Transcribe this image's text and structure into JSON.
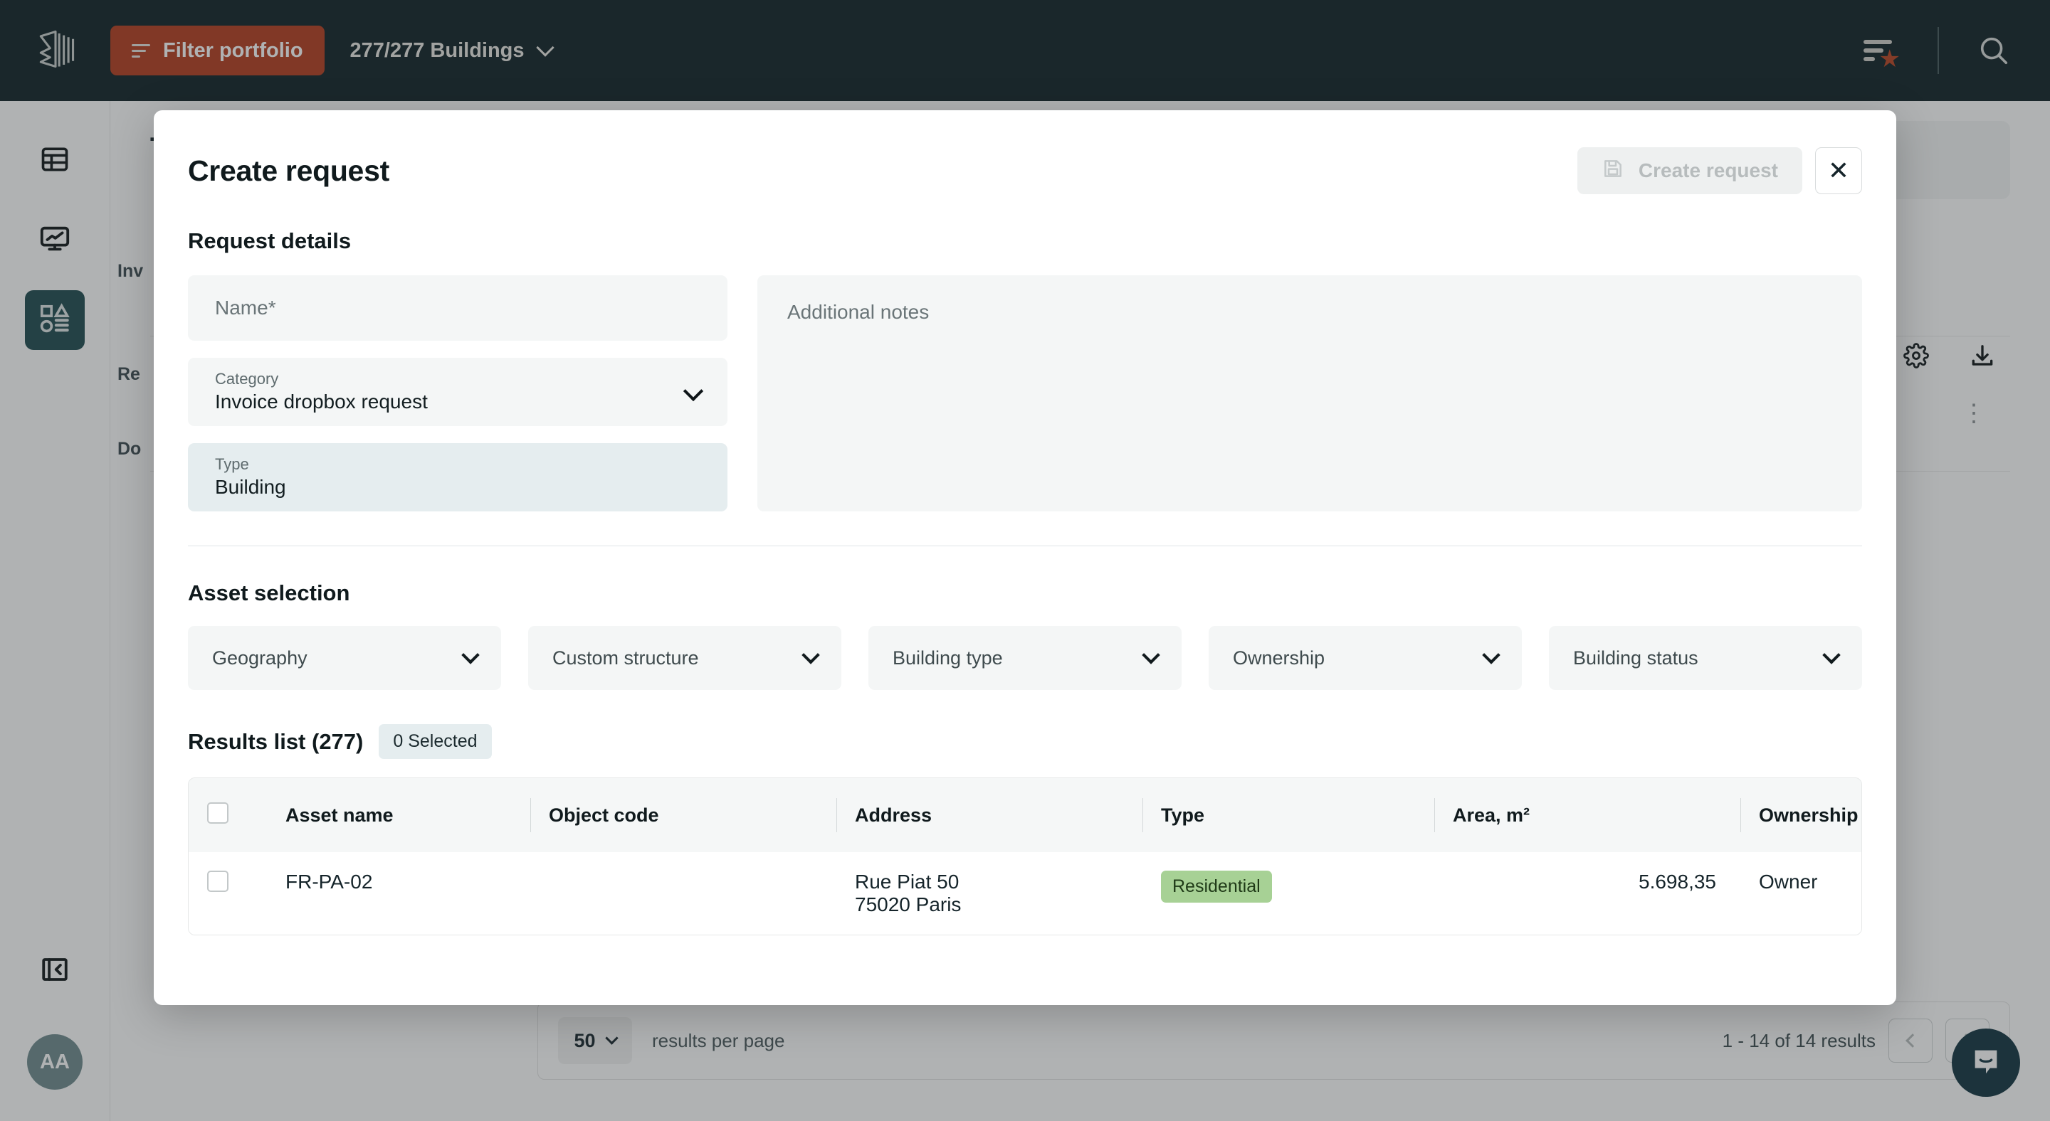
{
  "topbar": {
    "logo_icon": "building-logo-icon",
    "filter_button": {
      "label": "Filter portfolio",
      "icon": "filter-icon",
      "color": "#b33b1c"
    },
    "portfolio_select": {
      "label": "277/277 Buildings",
      "icon": "chevron-down-icon"
    },
    "saved_filters_icon": "saved-filter-star-icon",
    "search_icon": "search-icon",
    "background": "#0d2024"
  },
  "sidebar": {
    "items": [
      {
        "name": "table-view",
        "icon": "table-icon",
        "active": false
      },
      {
        "name": "analytics",
        "icon": "monitor-chart-icon",
        "active": false
      },
      {
        "name": "requests",
        "icon": "shapes-list-icon",
        "active": true
      }
    ],
    "collapse_icon": "collapse-sidebar-icon",
    "avatar_initials": "AA",
    "active_color": "#1d4a4e"
  },
  "background_page": {
    "title": "To",
    "subtitle_icon": "building-small-icon",
    "labels": [
      "Inv",
      "Re",
      "Do"
    ],
    "gear_icon": "gear-icon",
    "download_icon": "download-icon",
    "more_icon": "vertical-dots-icon",
    "pagination": {
      "per_page_value": "50",
      "per_page_chevron": "chevron-down-icon",
      "per_page_label": "results per page",
      "results_count": "1 -  14 of  14 results",
      "prev_icon": "chevron-left-icon",
      "next_icon": "chevron-right-icon"
    },
    "chat_fab_icon": "chat-bubble-icon"
  },
  "modal": {
    "title": "Create request",
    "create_button": {
      "label": "Create request",
      "icon": "save-icon",
      "disabled": true
    },
    "close_icon": "close-icon",
    "request_details": {
      "heading": "Request details",
      "name_field": {
        "placeholder": "Name*",
        "value": ""
      },
      "category_field": {
        "label": "Category",
        "value": "Invoice dropbox request",
        "icon": "chevron-down-icon"
      },
      "type_field": {
        "label": "Type",
        "value": "Building",
        "readonly": true
      },
      "notes_field": {
        "placeholder": "Additional notes",
        "value": ""
      }
    },
    "asset_selection": {
      "heading": "Asset selection",
      "filters": [
        {
          "label": "Geography",
          "icon": "chevron-down-icon"
        },
        {
          "label": "Custom structure",
          "icon": "chevron-down-icon"
        },
        {
          "label": "Building type",
          "icon": "chevron-down-icon"
        },
        {
          "label": "Ownership",
          "icon": "chevron-down-icon"
        },
        {
          "label": "Building status",
          "icon": "chevron-down-icon"
        }
      ]
    },
    "results": {
      "title": "Results list (277)",
      "selected_badge": "0 Selected",
      "columns": [
        "Asset name",
        "Object code",
        "Address",
        "Type",
        "Area, m²",
        "Ownership"
      ],
      "rows": [
        {
          "asset_name": "FR-PA-02",
          "object_code": "",
          "address_line1": "Rue Piat 50",
          "address_line2": "75020 Paris",
          "type": "Residential",
          "type_color": "#a7d195",
          "area": "5.698,35",
          "ownership": "Owner"
        }
      ]
    }
  }
}
